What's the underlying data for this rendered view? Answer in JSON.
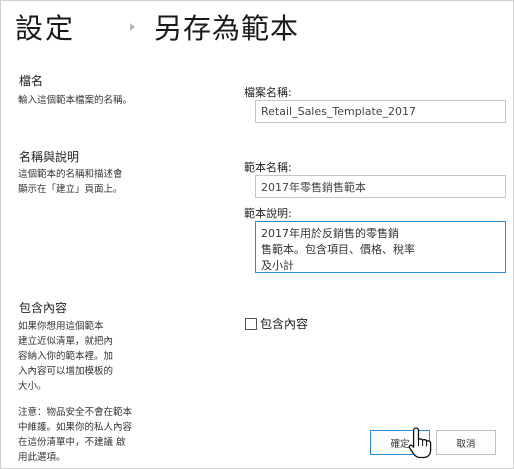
{
  "breadcrumb": {
    "root": "設定",
    "current": "另存為範本"
  },
  "file_name_section": {
    "title": "檔名",
    "description": "輸入這個範本檔案的名稱。",
    "field_label": "檔案名稱:",
    "field_value": "Retail_Sales_Template_2017"
  },
  "name_desc_section": {
    "title": "名稱與說明",
    "description_lines": [
      "這個範本的名稱和描述會",
      "顯示在「建立」頁面上。"
    ],
    "name_label": "範本名稱:",
    "name_value": "2017年零售銷售範本",
    "desc_label": "範本說明:",
    "desc_value": "2017年用於反銷售的零售銷\n售範本。包含項目、價格、稅率\n及小計"
  },
  "include_content_section": {
    "title": "包含內容",
    "description_lines": [
      "如果你想用這個範本",
      "建立近似清單，就把內",
      "容納入你的範本裡。加",
      "入內容可以增加模板的",
      "大小。"
    ],
    "note_lines": [
      "注意：物品安全不會在範本",
      "中維護。如果你的私人內容",
      "在這份清單中，不建議 啟",
      "用此選項。"
    ],
    "checkbox_label": "包含內容",
    "checkbox_checked": false
  },
  "buttons": {
    "ok": "確定",
    "cancel": "取消"
  }
}
